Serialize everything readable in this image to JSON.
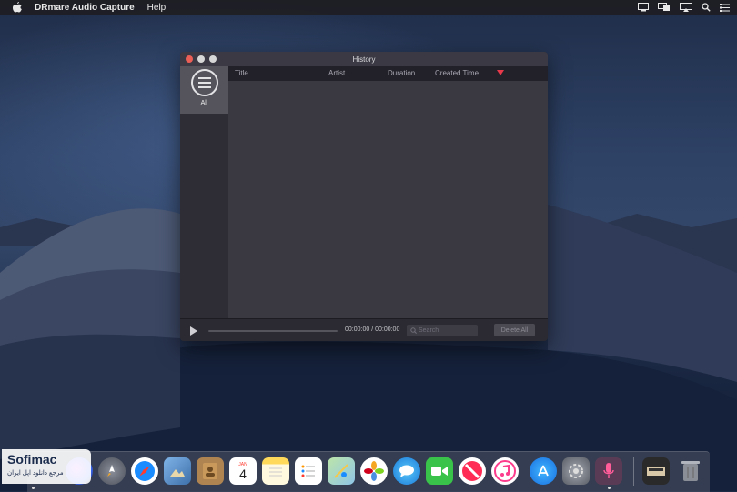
{
  "menubar": {
    "app_name": "DRmare Audio Capture",
    "menu_help": "Help",
    "right_icons": [
      "notification-icon",
      "display-icon",
      "airplay-icon",
      "spotlight-icon",
      "control-list-icon"
    ]
  },
  "window": {
    "title": "History",
    "sidebar": {
      "all_label": "All"
    },
    "columns": {
      "title": "Title",
      "artist": "Artist",
      "duration": "Duration",
      "created_time": "Created Time"
    },
    "player": {
      "time": "00:00:00 / 00:00:00",
      "search_placeholder": "Search",
      "delete_all": "Delete All"
    }
  },
  "dock": {
    "apps": [
      "siri",
      "launchpad",
      "safari",
      "mail-photo",
      "contacts",
      "calendar",
      "notes",
      "reminders",
      "maps",
      "photos",
      "messages",
      "facetime",
      "news",
      "itunes",
      "app-store",
      "system-preferences",
      "audio-capture",
      "downloads",
      "trash"
    ],
    "calendar_day": "4",
    "calendar_month": "JAN"
  },
  "watermark": {
    "brand": "Sofimac",
    "tagline": "مرجع دانلود اپل ایران"
  },
  "colors": {
    "close": "#ec5f57",
    "sort_arrow": "#e8394a",
    "window_bg": "#2b2a33",
    "list_bg": "#3a3942"
  }
}
